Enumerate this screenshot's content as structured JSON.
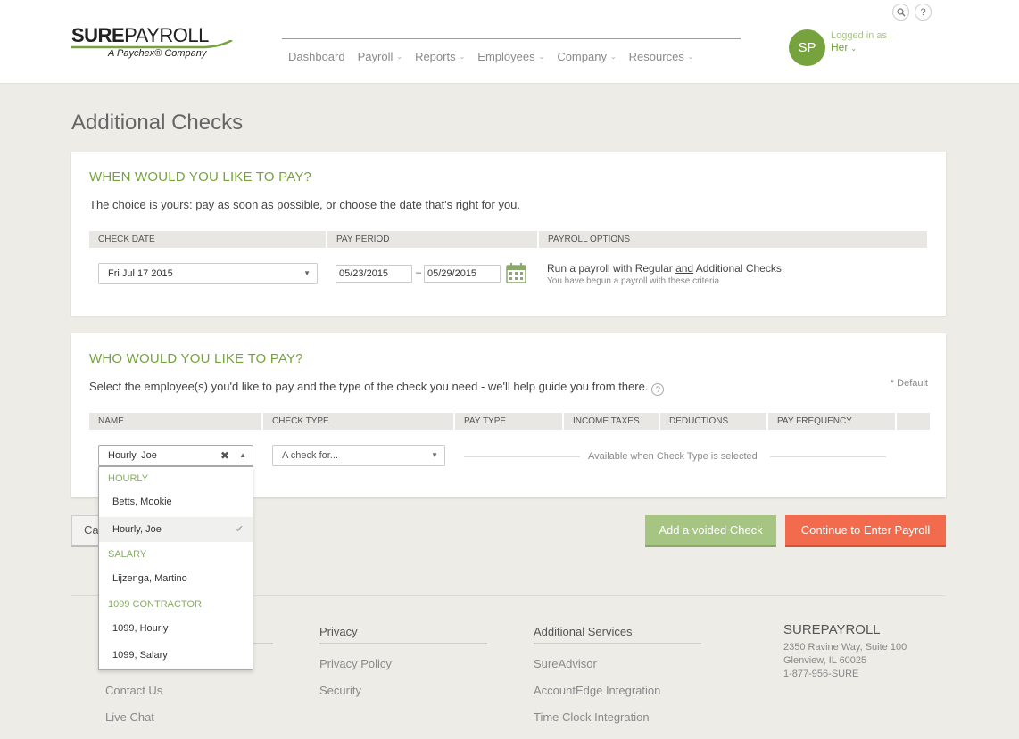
{
  "header": {
    "logo": {
      "brand_bold": "SURE",
      "brand_light": "PAYROLL",
      "tagline": "A Paychex® Company"
    },
    "nav": [
      {
        "label": "Dashboard",
        "has_menu": false
      },
      {
        "label": "Payroll",
        "has_menu": true
      },
      {
        "label": "Reports",
        "has_menu": true
      },
      {
        "label": "Employees",
        "has_menu": true
      },
      {
        "label": "Company",
        "has_menu": true
      },
      {
        "label": "Resources",
        "has_menu": true
      }
    ],
    "search_icon": "search-icon",
    "help_glyph": "?",
    "avatar_initials": "SP",
    "logged_in_label": "Logged in as ,",
    "user_name": "Her"
  },
  "page_title": "Additional Checks",
  "when_section": {
    "title": "WHEN WOULD YOU LIKE TO PAY?",
    "description": "The choice is yours: pay as soon as possible, or choose the date that's right for you.",
    "headers": [
      "CHECK DATE",
      "PAY PERIOD",
      "PAYROLL OPTIONS"
    ],
    "check_date": "Fri Jul 17 2015",
    "period_start": "05/23/2015",
    "period_sep": "–",
    "period_end": "05/29/2015",
    "option_pre": "Run a payroll with Regular ",
    "option_and": "and",
    "option_post": " Additional Checks.",
    "option_note": "You have begun a payroll with these criteria"
  },
  "who_section": {
    "title": "WHO WOULD YOU LIKE TO PAY?",
    "description": "Select the employee(s) you'd like to pay and the type of the check you need - we'll help guide you from there.",
    "help_glyph": "?",
    "default_note": "* Default",
    "headers": [
      "NAME",
      "CHECK TYPE",
      "PAY TYPE",
      "INCOME TAXES",
      "DEDUCTIONS",
      "PAY FREQUENCY",
      ""
    ],
    "name_value": "Hourly, Joe",
    "check_type_placeholder": "A check for...",
    "available_note": "Available when Check Type is selected"
  },
  "dropdown": {
    "groups": [
      {
        "label": "HOURLY",
        "items": [
          "Betts, Mookie",
          "Hourly, Joe"
        ]
      },
      {
        "label": "SALARY",
        "items": [
          "Lijzenga, Martino"
        ]
      },
      {
        "label": "1099 CONTRACTOR",
        "items": [
          "1099, Hourly",
          "1099, Salary"
        ]
      }
    ],
    "selected": "Hourly, Joe"
  },
  "buttons": {
    "cancel": "Cancel",
    "add_voided": "Add a voided Check",
    "continue": "Continue to Enter Payroll"
  },
  "footer": {
    "col1_links": [
      "Contact Us",
      "Live Chat"
    ],
    "privacy_head": "Privacy",
    "privacy_links": [
      "Privacy Policy",
      "Security"
    ],
    "services_head": "Additional Services",
    "services_links": [
      "SureAdvisor",
      "AccountEdge Integration",
      "Time Clock Integration"
    ],
    "company_name": "SUREPAYROLL",
    "address_line1": "2350 Ravine Way, Suite 100",
    "address_line2": "Glenview, IL 60025",
    "phone": "1-877-956-SURE"
  },
  "colors": {
    "brand_green": "#76a33e",
    "accent_orange": "#f26b4c",
    "button_green": "#a7c582"
  }
}
